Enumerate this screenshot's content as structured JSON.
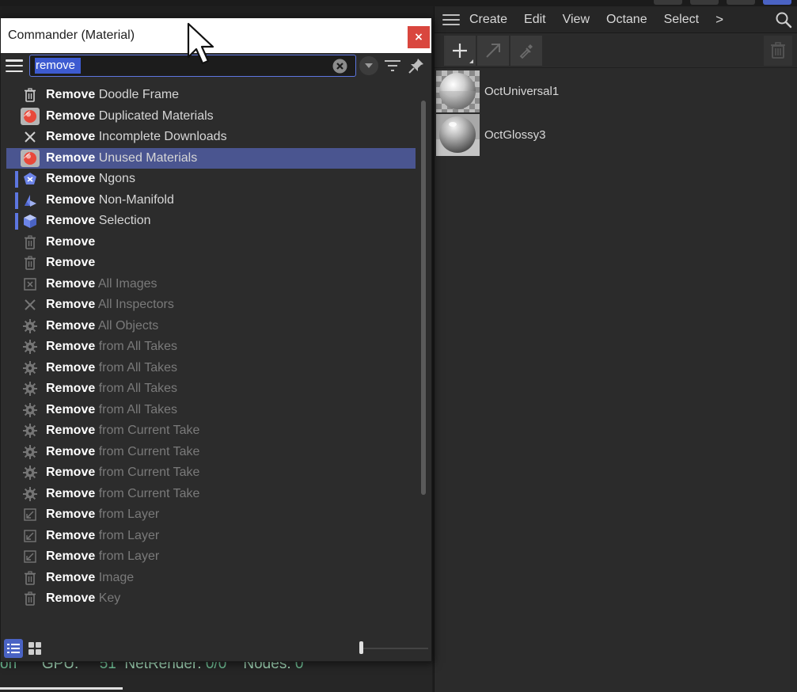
{
  "material_manager": {
    "menu": [
      "Create",
      "Edit",
      "View",
      "Octane",
      "Select"
    ],
    "more_label": ">",
    "materials": [
      {
        "name": "OctUniversal1"
      },
      {
        "name": "OctGlossy3"
      }
    ]
  },
  "commander": {
    "title": "Commander (Material)",
    "close_label": "×",
    "search_value": "remove",
    "results": [
      {
        "keyword": "Remove",
        "rest": "Doodle Frame",
        "icon": "trash-icon",
        "state": "normal"
      },
      {
        "keyword": "Remove",
        "rest": "Duplicated Materials",
        "icon": "material-sphere-icon",
        "state": "normal"
      },
      {
        "keyword": "Remove",
        "rest": "Incomplete Downloads",
        "icon": "x-mark-icon",
        "state": "normal"
      },
      {
        "keyword": "Remove",
        "rest": "Unused Materials",
        "icon": "material-sphere-icon",
        "state": "selected"
      },
      {
        "keyword": "Remove",
        "rest": "Ngons",
        "icon": "ngon-icon",
        "state": "marked"
      },
      {
        "keyword": "Remove",
        "rest": "Non-Manifold",
        "icon": "non-manifold-icon",
        "state": "marked"
      },
      {
        "keyword": "Remove",
        "rest": "Selection",
        "icon": "selection-cube-icon",
        "state": "marked"
      },
      {
        "keyword": "Remove",
        "rest": "",
        "icon": "trash-icon",
        "state": "dim"
      },
      {
        "keyword": "Remove",
        "rest": "",
        "icon": "trash-icon",
        "state": "dim"
      },
      {
        "keyword": "Remove",
        "rest": "All Images",
        "icon": "image-x-icon",
        "state": "dim"
      },
      {
        "keyword": "Remove",
        "rest": "All Inspectors",
        "icon": "x-mark-icon",
        "state": "dim"
      },
      {
        "keyword": "Remove",
        "rest": "All Objects",
        "icon": "gear-icon",
        "state": "dim"
      },
      {
        "keyword": "Remove",
        "rest": "from All Takes",
        "icon": "gear-icon",
        "state": "dim"
      },
      {
        "keyword": "Remove",
        "rest": "from All Takes",
        "icon": "gear-icon",
        "state": "dim"
      },
      {
        "keyword": "Remove",
        "rest": "from All Takes",
        "icon": "gear-icon",
        "state": "dim"
      },
      {
        "keyword": "Remove",
        "rest": "from All Takes",
        "icon": "gear-icon",
        "state": "dim"
      },
      {
        "keyword": "Remove",
        "rest": "from Current Take",
        "icon": "gear-icon",
        "state": "dim"
      },
      {
        "keyword": "Remove",
        "rest": "from Current Take",
        "icon": "gear-icon",
        "state": "dim"
      },
      {
        "keyword": "Remove",
        "rest": "from Current Take",
        "icon": "gear-icon",
        "state": "dim"
      },
      {
        "keyword": "Remove",
        "rest": "from Current Take",
        "icon": "gear-icon",
        "state": "dim"
      },
      {
        "keyword": "Remove",
        "rest": "from Layer",
        "icon": "layer-arrow-icon",
        "state": "dim"
      },
      {
        "keyword": "Remove",
        "rest": "from Layer",
        "icon": "layer-arrow-icon",
        "state": "dim"
      },
      {
        "keyword": "Remove",
        "rest": "from Layer",
        "icon": "layer-arrow-icon",
        "state": "dim"
      },
      {
        "keyword": "Remove",
        "rest": "Image",
        "icon": "trash-icon",
        "state": "dim"
      },
      {
        "keyword": "Remove",
        "rest": "Key",
        "icon": "trash-icon",
        "state": "dim"
      }
    ]
  },
  "status": {
    "prefix": "on",
    "gpu_label": "GPU:",
    "gpu_value": "51",
    "netrender_label": "NetRender:",
    "netrender_value": "0/0",
    "nodes_label": "Nodes:",
    "nodes_value": "0"
  },
  "colors": {
    "accent": "#5d76e0",
    "selected_row": "#4a5590",
    "close_button": "#d9463e",
    "status_text": "#6fbf95"
  }
}
